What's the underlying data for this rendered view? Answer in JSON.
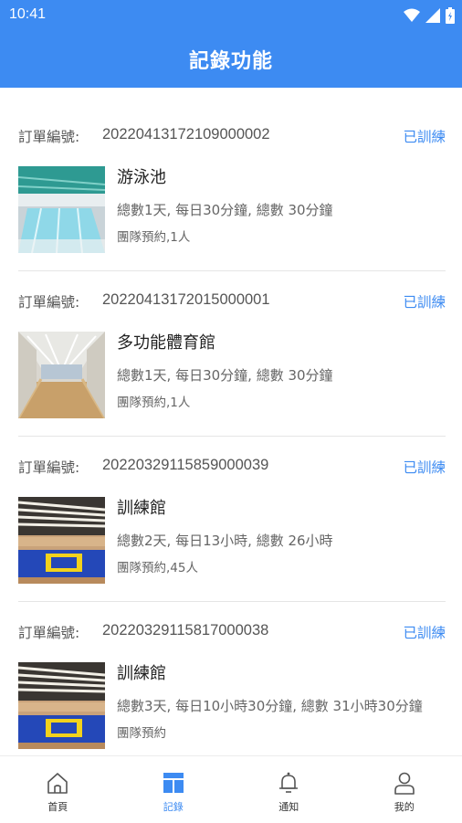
{
  "status_bar": {
    "time": "10:41"
  },
  "header": {
    "title": "記錄功能"
  },
  "orders": [
    {
      "label": "訂單編號:",
      "number": "2022041317210900000​2",
      "status": "已訓練",
      "venue": "游泳池",
      "detail": "總數1天, 每日30分鐘, 總數 30分鐘",
      "group": "團隊預約,1人",
      "image": "pool"
    },
    {
      "label": "訂單編號:",
      "number": "20220413172015000001",
      "status": "已訓練",
      "venue": "多功能體育館",
      "detail": "總數1天, 每日30分鐘, 總數 30分鐘",
      "group": "團隊預約,1人",
      "image": "gym"
    },
    {
      "label": "訂單編號:",
      "number": "20220329115859000039",
      "status": "已訓練",
      "venue": "訓練館",
      "detail": "總數2天, 每日13小時, 總數 26小時",
      "group": "團隊預約,45人",
      "image": "training"
    },
    {
      "label": "訂單編號:",
      "number": "20220329115817000038",
      "status": "已訓練",
      "venue": "訓練館",
      "detail": "總數3天, 每日10小時30分鐘, 總數 31小時30分鐘",
      "group": "團隊預約",
      "image": "training"
    }
  ],
  "tabs": [
    {
      "label": "首頁",
      "icon": "home-icon",
      "active": false
    },
    {
      "label": "記錄",
      "icon": "records-icon",
      "active": true
    },
    {
      "label": "通知",
      "icon": "bell-icon",
      "active": false
    },
    {
      "label": "我的",
      "icon": "user-icon",
      "active": false
    }
  ],
  "colors": {
    "primary": "#3d8bf2",
    "text": "#222222",
    "muted": "#666666"
  }
}
